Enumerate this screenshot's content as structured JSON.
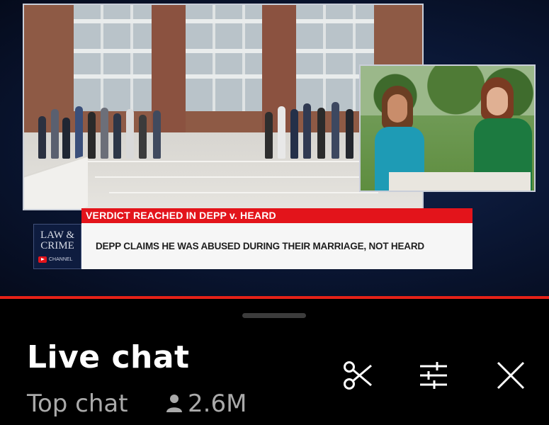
{
  "video": {
    "headline": "VERDICT REACHED IN DEPP v. HEARD",
    "caption": "DEPP CLAIMS HE WAS ABUSED DURING THEIR MARRIAGE, NOT HEARD",
    "logo": {
      "line1": "LAW & CRIME",
      "line2": "",
      "channel_label": "CHANNEL"
    },
    "progress_color": "#e62117"
  },
  "live_chat": {
    "title": "Live chat",
    "mode": "Top chat",
    "viewer_count": "2.6M",
    "icons": [
      "scissors-icon",
      "sliders-icon",
      "close-icon"
    ]
  },
  "colors": {
    "accent_red": "#e3141b",
    "background": "#000000",
    "secondary_text": "#aaaaaa"
  }
}
